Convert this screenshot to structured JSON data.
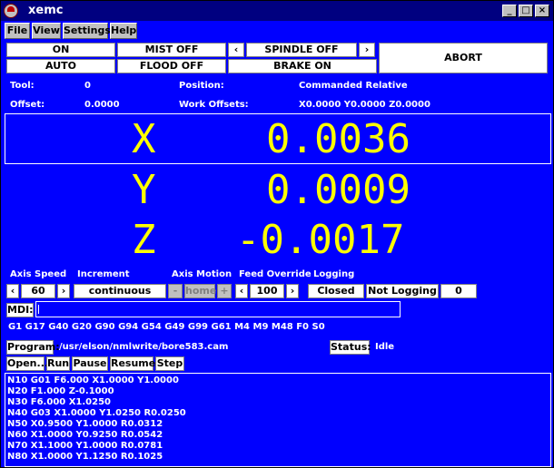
{
  "window": {
    "title": "xemc",
    "controls": [
      "_",
      "□",
      "×"
    ]
  },
  "menu": [
    "File",
    "View",
    "Settings",
    "Help"
  ],
  "buttons": {
    "on": "ON",
    "mist": "MIST OFF",
    "spindle_left": "‹",
    "spindle": "SPINDLE OFF",
    "spindle_right": "›",
    "abort": "ABORT",
    "auto": "AUTO",
    "flood": "FLOOD OFF",
    "brake": "BRAKE ON"
  },
  "status": {
    "tool_label": "Tool:",
    "tool_value": "0",
    "position_label": "Position:",
    "position_value": "Commanded Relative",
    "offset_label": "Offset:",
    "offset_value": "0.0000",
    "work_offsets_label": "Work Offsets:",
    "work_offsets_value": "X0.0000  Y0.0000  Z0.0000"
  },
  "dro": {
    "x_label": "X",
    "x_value": "0.0036",
    "y_label": "Y",
    "y_value": "0.0009",
    "z_label": "Z",
    "z_value": "-0.0017"
  },
  "controls": {
    "axis_speed_label": "Axis Speed",
    "axis_speed_value": "60",
    "increment_label": "Increment",
    "increment_value": "continuous",
    "axis_motion_label": "Axis Motion",
    "axis_motion_value": "home",
    "feed_override_label": "Feed Override",
    "feed_override_value": "100",
    "logging_label": "Logging",
    "logging_closed": "Closed",
    "logging_state": "Not Logging",
    "logging_count": "0",
    "left_arrow": "‹",
    "right_arrow": "›",
    "minus": "-",
    "plus": "+"
  },
  "mdi": {
    "label": "MDI:",
    "value": ""
  },
  "active_codes": "G1 G17 G40 G20 G90 G94 G54 G49 G99 G61  M4 M9 M48  F0 S0",
  "program": {
    "label": "Program:",
    "path": "/usr/elson/nmlwrite/bore583.cam",
    "status_label": "Status:",
    "status_value": "Idle",
    "buttons": [
      "Open...",
      "Run",
      "Pause",
      "Resume",
      "Step"
    ],
    "lines": [
      "N10 G01 F6.000 X1.0000 Y1.0000",
      "N20 F1.000 Z-0.1000",
      "N30 F6.000 X1.0250",
      "N40 G03 X1.0000 Y1.0250 R0.0250",
      "N50 X0.9500 Y1.0000 R0.0312",
      "N60 X1.0000 Y0.9250 R0.0542",
      "N70 X1.1000 Y1.0000 R0.0781",
      "N80 X1.0000 Y1.1250 R0.1025"
    ]
  }
}
